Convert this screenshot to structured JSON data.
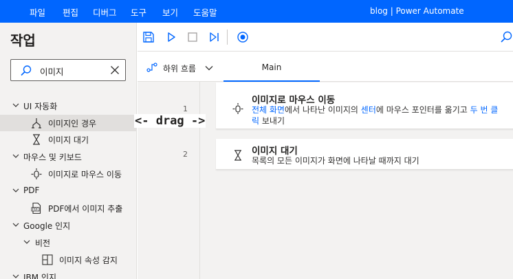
{
  "menubar": {
    "items": [
      "파일",
      "편집",
      "디버그",
      "도구",
      "보기",
      "도움말"
    ],
    "title": "blog | Power Automate"
  },
  "actions_pane": {
    "title": "작업",
    "search": {
      "value": "이미지",
      "icon": "search-icon"
    },
    "tree": [
      {
        "label": "UI 자동화",
        "kind": "group",
        "expanded": true
      },
      {
        "label": "이미지인 경우",
        "kind": "item",
        "icon": "if-image-icon",
        "selected": true
      },
      {
        "label": "이미지 대기",
        "kind": "item",
        "icon": "hourglass-icon"
      },
      {
        "label": "마우스 및 키보드",
        "kind": "group",
        "expanded": true
      },
      {
        "label": "이미지로 마우스 이동",
        "kind": "item",
        "icon": "mouse-move-icon"
      },
      {
        "label": "PDF",
        "kind": "group",
        "expanded": true
      },
      {
        "label": "PDF에서 이미지 추출",
        "kind": "item",
        "icon": "pdf-icon"
      },
      {
        "label": "Google 인지",
        "kind": "group",
        "expanded": true
      },
      {
        "label": "비전",
        "kind": "subgroup",
        "expanded": true
      },
      {
        "label": "이미지 속성 감지",
        "kind": "item",
        "icon": "image-properties-icon"
      },
      {
        "label": "IBM 인지",
        "kind": "group",
        "expanded": true
      }
    ]
  },
  "toolbar": {
    "buttons": [
      "save-icon",
      "run-icon",
      "stop-icon",
      "step-icon",
      "record-icon",
      "search-icon"
    ]
  },
  "subflow": {
    "label": "하위 흐름",
    "tab": "Main"
  },
  "flow": [
    {
      "line": "1",
      "title": "이미지로 마우스 이동",
      "icon": "mouse-move-icon",
      "desc": {
        "p1": "전체 화면",
        "p2": "에서 나타난 이미지의 ",
        "p3": "센터",
        "p4": "에 마우스 포인터를 옮기고 ",
        "p5": "두 번 클릭",
        "p6": " 보내기"
      }
    },
    {
      "line": "2",
      "title": "이미지 대기",
      "icon": "hourglass-icon",
      "desc": {
        "p1": "목록의 모든 이미지가 화면에 나타날 때까지 대기"
      }
    }
  ],
  "overlay": {
    "drag_text": "<- drag ->"
  },
  "colors": {
    "accent": "#0066ff",
    "pane_bg": "#f3f2f1",
    "selected_bg": "#e1dfdd"
  }
}
